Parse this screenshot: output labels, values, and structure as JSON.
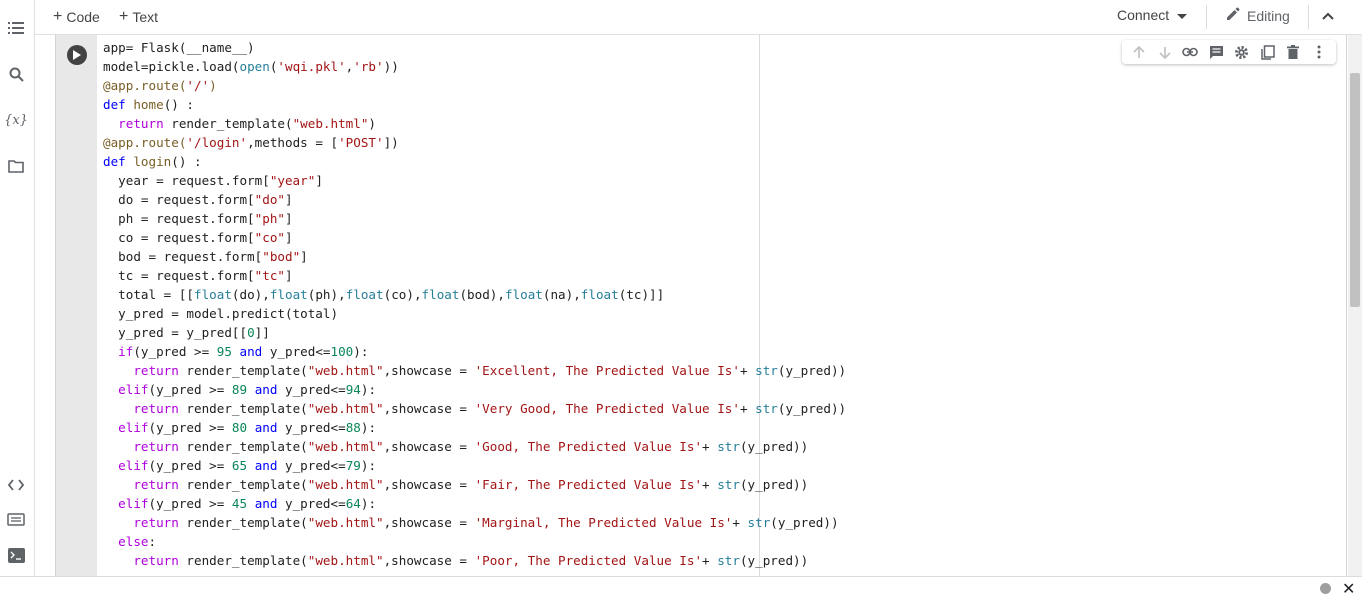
{
  "toolbar": {
    "add_code_label": "Code",
    "add_text_label": "Text",
    "connect_label": "Connect",
    "editing_label": "Editing"
  },
  "sidebar": {
    "icons": [
      "table-of-contents-icon",
      "search-icon",
      "variables-icon",
      "files-icon",
      "code-snippets-icon",
      "command-palette-icon",
      "terminal-icon"
    ]
  },
  "cell_toolbar": {
    "icons": [
      "move-up-icon",
      "move-down-icon",
      "link-icon",
      "comment-icon",
      "settings-icon",
      "mirror-cell-icon",
      "delete-icon",
      "more-icon"
    ]
  },
  "code": {
    "lines": [
      [
        [
          "t",
          "app= Flask(__name__)"
        ]
      ],
      [
        [
          "t",
          "model=pickle.load("
        ],
        [
          "f",
          "open"
        ],
        [
          "t",
          "("
        ],
        [
          "s",
          "'wqi.pkl'"
        ],
        [
          "t",
          ","
        ],
        [
          "s",
          "'rb'"
        ],
        [
          "t",
          "))"
        ]
      ],
      [
        [
          "d",
          "@app.route("
        ],
        [
          "s",
          "'/'"
        ],
        [
          "d",
          ")"
        ]
      ],
      [
        [
          "k",
          "def"
        ],
        [
          "t",
          " "
        ],
        [
          "d",
          "home"
        ],
        [
          "t",
          "() :"
        ]
      ],
      [
        [
          "t",
          "  "
        ],
        [
          "r",
          "return"
        ],
        [
          "t",
          " render_template("
        ],
        [
          "s",
          "\"web.html\""
        ],
        [
          "t",
          ")"
        ]
      ],
      [
        [
          "d",
          "@app.route("
        ],
        [
          "s",
          "'/login'"
        ],
        [
          "t",
          ",methods = ["
        ],
        [
          "s",
          "'POST'"
        ],
        [
          "t",
          "])"
        ]
      ],
      [
        [
          "k",
          "def"
        ],
        [
          "t",
          " "
        ],
        [
          "d",
          "login"
        ],
        [
          "t",
          "() :"
        ]
      ],
      [
        [
          "t",
          "  year = request.form["
        ],
        [
          "s",
          "\"year\""
        ],
        [
          "t",
          "]"
        ]
      ],
      [
        [
          "t",
          "  do = request.form["
        ],
        [
          "s",
          "\"do\""
        ],
        [
          "t",
          "]"
        ]
      ],
      [
        [
          "t",
          "  ph = request.form["
        ],
        [
          "s",
          "\"ph\""
        ],
        [
          "t",
          "]"
        ]
      ],
      [
        [
          "t",
          "  co = request.form["
        ],
        [
          "s",
          "\"co\""
        ],
        [
          "t",
          "]"
        ]
      ],
      [
        [
          "t",
          "  bod = request.form["
        ],
        [
          "s",
          "\"bod\""
        ],
        [
          "t",
          "]"
        ]
      ],
      [
        [
          "t",
          "  tc = request.form["
        ],
        [
          "s",
          "\"tc\""
        ],
        [
          "t",
          "]"
        ]
      ],
      [
        [
          "t",
          "  total = [["
        ],
        [
          "f",
          "float"
        ],
        [
          "t",
          "(do),"
        ],
        [
          "f",
          "float"
        ],
        [
          "t",
          "(ph),"
        ],
        [
          "f",
          "float"
        ],
        [
          "t",
          "(co),"
        ],
        [
          "f",
          "float"
        ],
        [
          "t",
          "(bod),"
        ],
        [
          "f",
          "float"
        ],
        [
          "t",
          "(na),"
        ],
        [
          "f",
          "float"
        ],
        [
          "t",
          "(tc)]]"
        ]
      ],
      [
        [
          "t",
          "  y_pred = model.predict(total)"
        ]
      ],
      [
        [
          "t",
          "  y_pred = y_pred[["
        ],
        [
          "n",
          "0"
        ],
        [
          "t",
          "]]"
        ]
      ],
      [
        [
          "t",
          "  "
        ],
        [
          "r",
          "if"
        ],
        [
          "t",
          "(y_pred >= "
        ],
        [
          "n",
          "95"
        ],
        [
          "t",
          " "
        ],
        [
          "k",
          "and"
        ],
        [
          "t",
          " y_pred<="
        ],
        [
          "n",
          "100"
        ],
        [
          "t",
          "):"
        ]
      ],
      [
        [
          "t",
          "    "
        ],
        [
          "r",
          "return"
        ],
        [
          "t",
          " render_template("
        ],
        [
          "s",
          "\"web.html\""
        ],
        [
          "t",
          ",showcase = "
        ],
        [
          "s",
          "'Excellent, The Predicted Value Is'"
        ],
        [
          "t",
          "+ "
        ],
        [
          "f",
          "str"
        ],
        [
          "t",
          "(y_pred))"
        ]
      ],
      [
        [
          "t",
          "  "
        ],
        [
          "r",
          "elif"
        ],
        [
          "t",
          "(y_pred >= "
        ],
        [
          "n",
          "89"
        ],
        [
          "t",
          " "
        ],
        [
          "k",
          "and"
        ],
        [
          "t",
          " y_pred<="
        ],
        [
          "n",
          "94"
        ],
        [
          "t",
          "):"
        ]
      ],
      [
        [
          "t",
          "    "
        ],
        [
          "r",
          "return"
        ],
        [
          "t",
          " render_template("
        ],
        [
          "s",
          "\"web.html\""
        ],
        [
          "t",
          ",showcase = "
        ],
        [
          "s",
          "'Very Good, The Predicted Value Is'"
        ],
        [
          "t",
          "+ "
        ],
        [
          "f",
          "str"
        ],
        [
          "t",
          "(y_pred))"
        ]
      ],
      [
        [
          "t",
          "  "
        ],
        [
          "r",
          "elif"
        ],
        [
          "t",
          "(y_pred >= "
        ],
        [
          "n",
          "80"
        ],
        [
          "t",
          " "
        ],
        [
          "k",
          "and"
        ],
        [
          "t",
          " y_pred<="
        ],
        [
          "n",
          "88"
        ],
        [
          "t",
          "):"
        ]
      ],
      [
        [
          "t",
          "    "
        ],
        [
          "r",
          "return"
        ],
        [
          "t",
          " render_template("
        ],
        [
          "s",
          "\"web.html\""
        ],
        [
          "t",
          ",showcase = "
        ],
        [
          "s",
          "'Good, The Predicted Value Is'"
        ],
        [
          "t",
          "+ "
        ],
        [
          "f",
          "str"
        ],
        [
          "t",
          "(y_pred))"
        ]
      ],
      [
        [
          "t",
          "  "
        ],
        [
          "r",
          "elif"
        ],
        [
          "t",
          "(y_pred >= "
        ],
        [
          "n",
          "65"
        ],
        [
          "t",
          " "
        ],
        [
          "k",
          "and"
        ],
        [
          "t",
          " y_pred<="
        ],
        [
          "n",
          "79"
        ],
        [
          "t",
          "):"
        ]
      ],
      [
        [
          "t",
          "    "
        ],
        [
          "r",
          "return"
        ],
        [
          "t",
          " render_template("
        ],
        [
          "s",
          "\"web.html\""
        ],
        [
          "t",
          ",showcase = "
        ],
        [
          "s",
          "'Fair, The Predicted Value Is'"
        ],
        [
          "t",
          "+ "
        ],
        [
          "f",
          "str"
        ],
        [
          "t",
          "(y_pred))"
        ]
      ],
      [
        [
          "t",
          "  "
        ],
        [
          "r",
          "elif"
        ],
        [
          "t",
          "(y_pred >= "
        ],
        [
          "n",
          "45"
        ],
        [
          "t",
          " "
        ],
        [
          "k",
          "and"
        ],
        [
          "t",
          " y_pred<="
        ],
        [
          "n",
          "64"
        ],
        [
          "t",
          "):"
        ]
      ],
      [
        [
          "t",
          "    "
        ],
        [
          "r",
          "return"
        ],
        [
          "t",
          " render_template("
        ],
        [
          "s",
          "\"web.html\""
        ],
        [
          "t",
          ",showcase = "
        ],
        [
          "s",
          "'Marginal, The Predicted Value Is'"
        ],
        [
          "t",
          "+ "
        ],
        [
          "f",
          "str"
        ],
        [
          "t",
          "(y_pred))"
        ]
      ],
      [
        [
          "t",
          "  "
        ],
        [
          "r",
          "else"
        ],
        [
          "t",
          ":"
        ]
      ],
      [
        [
          "t",
          "    "
        ],
        [
          "r",
          "return"
        ],
        [
          "t",
          " render_template("
        ],
        [
          "s",
          "\"web.html\""
        ],
        [
          "t",
          ",showcase = "
        ],
        [
          "s",
          "'Poor, The Predicted Value Is'"
        ],
        [
          "t",
          "+ "
        ],
        [
          "f",
          "str"
        ],
        [
          "t",
          "(y_pred))"
        ]
      ]
    ]
  }
}
